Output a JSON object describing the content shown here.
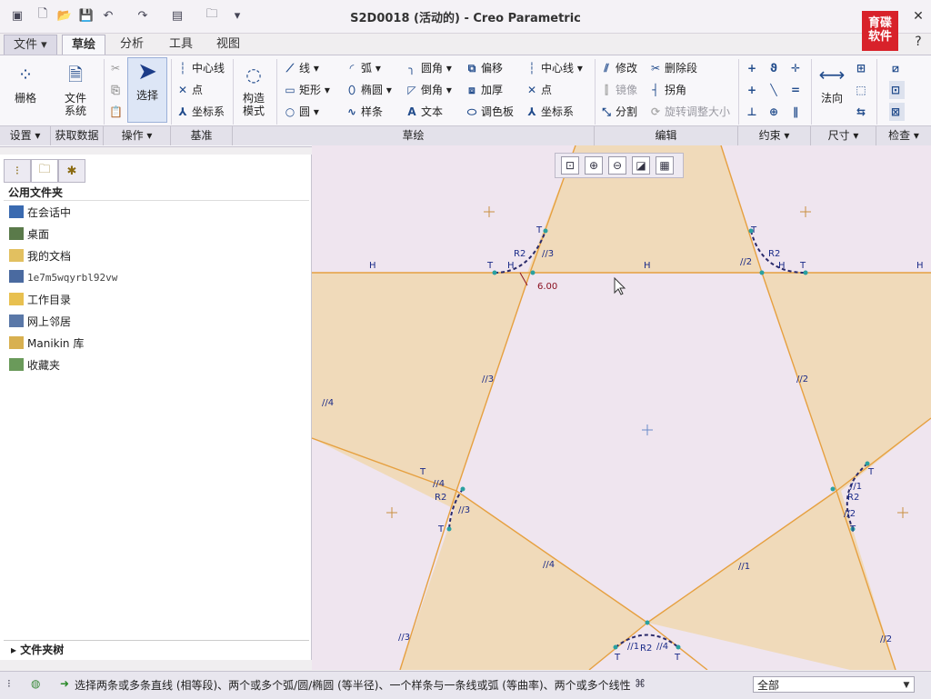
{
  "window": {
    "title": "S2D0018 (活动的) - Creo Parametric"
  },
  "quick_access": [
    "app-icon",
    "new-icon",
    "open-icon",
    "save-icon",
    "undo-icon",
    "redo-icon",
    "windows-icon",
    "folder-icon",
    "customize-icon"
  ],
  "logo": {
    "line1": "育碟",
    "line2": "软件"
  },
  "tabs": {
    "file": "文件",
    "sketch": "草绘",
    "analysis": "分析",
    "tools": "工具",
    "view": "视图"
  },
  "ribbon": {
    "grid": "栅格",
    "file_system": "文件\n系统",
    "select": "选择",
    "construct_mode": "构造\n模式",
    "datum": {
      "centerline": "中心线",
      "point": "点",
      "csys": "坐标系"
    },
    "sketch": {
      "line": "线",
      "rectangle": "矩形",
      "circle": "圆",
      "arc": "弧",
      "ellipse": "椭圆",
      "spline": "样条",
      "fillet": "圆角",
      "chamfer": "倒角",
      "text": "文本",
      "offset": "偏移",
      "thicken": "加厚",
      "palette": "调色板",
      "centerline": "中心线",
      "point": "点",
      "csys": "坐标系"
    },
    "edit": {
      "modify": "修改",
      "delete_segment": "删除段",
      "mirror": "镜像",
      "corner": "拐角",
      "divide": "分割",
      "rotate_resize": "旋转调整大小"
    },
    "normal": "法向",
    "groups": {
      "setup": "设置",
      "get_data": "获取数据",
      "operations": "操作",
      "datum": "基准",
      "sketching": "草绘",
      "editing": "编辑",
      "constrain": "约束",
      "dimension": "尺寸",
      "inspect": "检查"
    }
  },
  "left_panel": {
    "header": "公用文件夹",
    "items": [
      "在会话中",
      "桌面",
      "我的文档",
      "1e7m5wqyrbl92vw",
      "工作目录",
      "网上邻居",
      "Manikin 库",
      "收藏夹"
    ],
    "folder_tree": "文件夹树"
  },
  "sketch": {
    "dimension": "6.00",
    "labels": {
      "H": "H",
      "T": "T",
      "R2": "R2",
      "p1": "//1",
      "p2": "//2",
      "p3": "//3",
      "p4": "//4"
    }
  },
  "status": {
    "message": "选择两条或多条直线 (相等段)、两个或多个弧/圆/椭圆 (等半径)、一个样条与一条线或弧 (等曲率)、两个或多个线性",
    "filter": "全部"
  },
  "colors": {
    "fill": "#f0d8b0",
    "edge": "#e6a040",
    "background": "#efe5ef",
    "constraint": "#1a2a88",
    "dimension": "#8a1020"
  }
}
